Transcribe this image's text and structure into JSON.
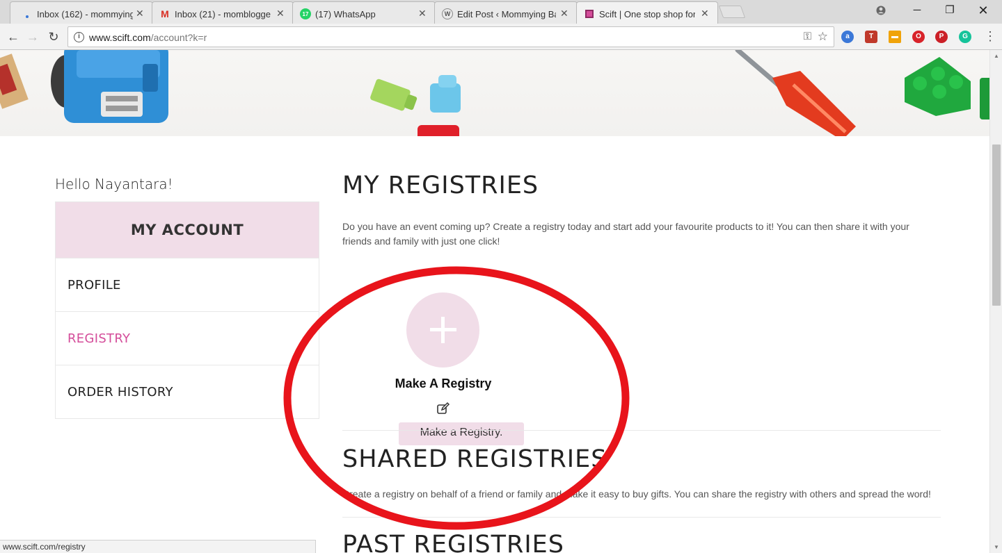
{
  "browser": {
    "tabs": [
      {
        "title": "Inbox (162) - mommying",
        "favicon": "gmail-blue-icon",
        "active": false
      },
      {
        "title": "Inbox (21) - momblogge",
        "favicon": "gmail-icon",
        "active": false
      },
      {
        "title": "(17) WhatsApp",
        "favicon": "whatsapp-icon",
        "favicon_text": "17",
        "active": false
      },
      {
        "title": "Edit Post ‹ Mommying Ba",
        "favicon": "wordpress-icon",
        "active": false
      },
      {
        "title": "Scift | One stop shop for",
        "favicon": "gift-icon",
        "active": true
      }
    ],
    "address": {
      "domain": "www.scift.com",
      "path": "/account?k=r"
    },
    "status_url": "www.scift.com/registry",
    "extensions": [
      {
        "name": "app-a-icon",
        "color": "#3b78d8",
        "glyph": "a"
      },
      {
        "name": "translate-icon",
        "color": "#c0392b",
        "glyph": "T"
      },
      {
        "name": "notes-icon",
        "color": "#f0a30a",
        "glyph": "▬"
      },
      {
        "name": "opera-icon",
        "color": "#d8232a",
        "glyph": "O"
      },
      {
        "name": "pinterest-icon",
        "color": "#cb2027",
        "glyph": "P"
      },
      {
        "name": "grammarly-icon",
        "color": "#15c39a",
        "glyph": "G"
      }
    ]
  },
  "sidebar": {
    "greeting": "Hello Nayantara!",
    "header": "MY ACCOUNT",
    "items": [
      {
        "label": "PROFILE",
        "active": false
      },
      {
        "label": "REGISTRY",
        "active": true
      },
      {
        "label": "ORDER HISTORY",
        "active": false
      }
    ]
  },
  "main": {
    "my_registries": {
      "title": "MY REGISTRIES",
      "description": "Do you have an event coming up? Create a registry today and start add your favourite products to it! You can then share it with your friends and family with just one click!",
      "make_label": "Make A Registry",
      "tooltip": "Make a Registry."
    },
    "shared_registries": {
      "title": "SHARED REGISTRIES",
      "description": "Create a registry on behalf of a friend or family and make it easy to buy gifts. You can share the registry with others and spread the word!"
    },
    "past_registries": {
      "title": "PAST REGISTRIES"
    }
  },
  "colors": {
    "accent_pink": "#d44d9a",
    "soft_pink": "#f1dde8",
    "annotation_red": "#e8141b"
  }
}
